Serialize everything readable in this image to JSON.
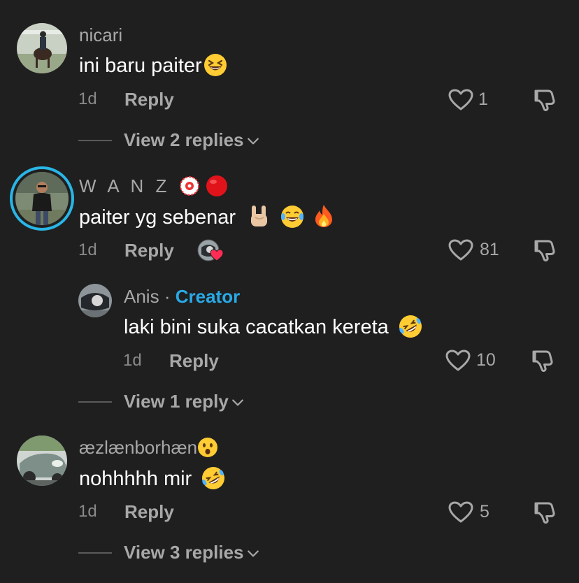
{
  "colors": {
    "background": "#1f1f1f",
    "creator_accent": "#29a9e6",
    "story_ring": "#29b6e6",
    "liked_red": "#ff2d55"
  },
  "comments": [
    {
      "username": "nicari",
      "text": "ini baru paiter",
      "emojis": [
        "grinning-squinting-face"
      ],
      "time": "1d",
      "reply_label": "Reply",
      "likes": "1",
      "view_replies": "View 2 replies"
    },
    {
      "username": "W A N Z",
      "username_emojis": [
        "red-flower-badge",
        "red-circle"
      ],
      "text": "paiter yg sebenar",
      "emojis": [
        "sign-of-horns",
        "face-with-tears-of-joy",
        "fire"
      ],
      "time": "1d",
      "reply_label": "Reply",
      "likes": "81",
      "liked_by_creator": true,
      "reply": {
        "username": "Anis",
        "separator": "·",
        "badge": "Creator",
        "text": "laki bini suka cacatkan kereta",
        "emojis": [
          "rolling-on-the-floor-laughing"
        ],
        "time": "1d",
        "reply_label": "Reply",
        "likes": "10"
      },
      "view_replies": "View 1 reply"
    },
    {
      "username": "æzlænborhæn",
      "username_emojis": [
        "hushed-face"
      ],
      "text": "nohhhhh mir",
      "emojis": [
        "rolling-on-the-floor-laughing"
      ],
      "time": "1d",
      "reply_label": "Reply",
      "likes": "5",
      "view_replies": "View 3 replies"
    }
  ]
}
